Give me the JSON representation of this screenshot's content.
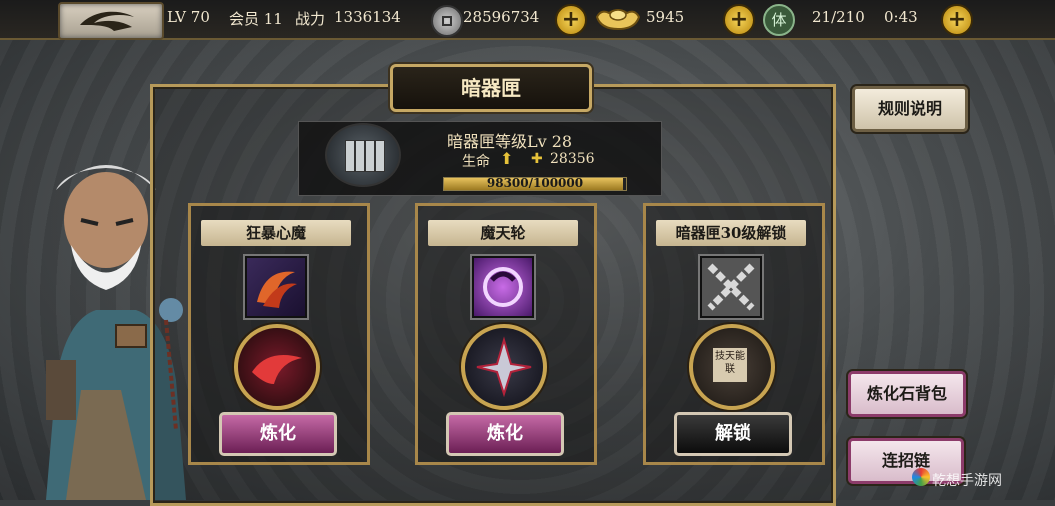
{
  "topbar": {
    "level": "LV 70",
    "vip": "会员 11",
    "power_label": "战力",
    "power_value": "1336134",
    "coins": "28596734",
    "ingots": "5945",
    "stamina_icon_label": "体",
    "stamina": "21/210",
    "timer": "0:43",
    "plus": "+"
  },
  "panel": {
    "title": "暗器匣"
  },
  "side_buttons": {
    "rules": "规则说明",
    "stone_bag": "炼化石背包",
    "combo_chain": "连招链"
  },
  "info": {
    "title": "暗器匣等级Lv 28",
    "hp_label": "生命",
    "hp_bonus": "28356",
    "exp_current": 98300,
    "exp_max": 100000,
    "exp_text": "98300/100000"
  },
  "cards": [
    {
      "title": "狂暴心魔",
      "button": "炼化"
    },
    {
      "title": "魔天轮",
      "button": "炼化"
    },
    {
      "title": "暗器匣30级解锁",
      "orb_label": "技天能联",
      "button": "解锁"
    }
  ],
  "watermark": "乾想手游网",
  "colors": {
    "accent_gold": "#c8a451",
    "button_pink": "#8c3b6a",
    "exp_fill": "#e7c25d"
  }
}
